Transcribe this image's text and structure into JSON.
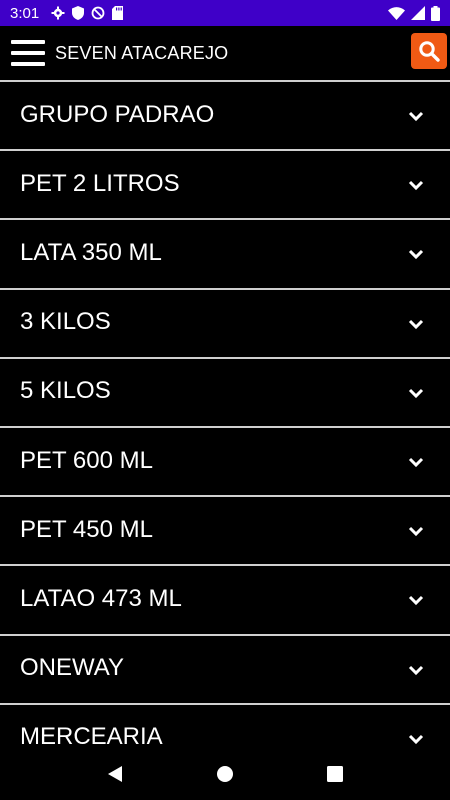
{
  "status_bar": {
    "time": "3:01",
    "left_icons": [
      "gear-icon",
      "shield-icon",
      "no-sync-icon",
      "sd-card-icon"
    ],
    "right_icons": [
      "wifi-icon",
      "signal-icon",
      "battery-icon"
    ],
    "background_color": "#3f00c8"
  },
  "header": {
    "title": "SEVEN ATACAREJO",
    "menu_icon": "hamburger-menu-icon",
    "search_icon": "search-icon",
    "search_color": "#f05a14"
  },
  "categories": [
    {
      "label": "GRUPO PADRAO"
    },
    {
      "label": "PET 2 LITROS"
    },
    {
      "label": "LATA 350 ML"
    },
    {
      "label": "3 KILOS"
    },
    {
      "label": "5 KILOS"
    },
    {
      "label": "PET 600 ML"
    },
    {
      "label": "PET 450 ML"
    },
    {
      "label": "LATAO 473 ML"
    },
    {
      "label": "ONEWAY"
    },
    {
      "label": "MERCEARIA"
    }
  ],
  "nav_bar": {
    "icons": [
      "back-icon",
      "home-icon",
      "recents-icon"
    ]
  }
}
